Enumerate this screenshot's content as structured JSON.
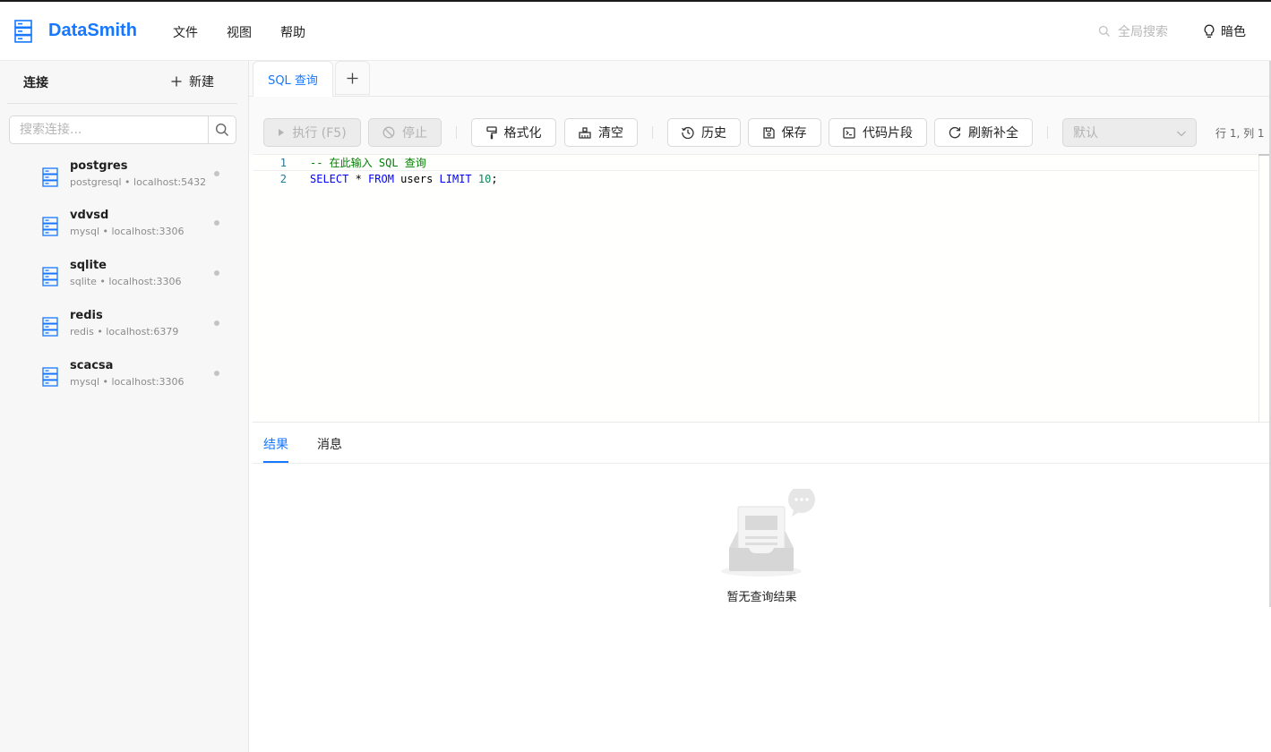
{
  "header": {
    "app_title": "DataSmith",
    "menu": [
      "文件",
      "视图",
      "帮助"
    ],
    "global_search_placeholder": "全局搜索",
    "theme_label": "暗色"
  },
  "sidebar": {
    "title": "连接",
    "new_label": "新建",
    "search_placeholder": "搜索连接...",
    "connections": [
      {
        "name": "postgres",
        "meta": "postgresql • localhost:5432"
      },
      {
        "name": "vdvsd",
        "meta": "mysql • localhost:3306"
      },
      {
        "name": "sqlite",
        "meta": "sqlite • localhost:3306"
      },
      {
        "name": "redis",
        "meta": "redis • localhost:6379"
      },
      {
        "name": "scacsa",
        "meta": "mysql • localhost:3306"
      }
    ]
  },
  "tabs": {
    "active_label": "SQL 查询",
    "add_label": "+"
  },
  "toolbar": {
    "run_label": "执行 (F5)",
    "stop_label": "停止",
    "format_label": "格式化",
    "clear_label": "清空",
    "history_label": "历史",
    "save_label": "保存",
    "snippets_label": "代码片段",
    "refresh_label": "刷新补全",
    "database_select": "默认",
    "cursor_position": "行 1, 列 1"
  },
  "editor": {
    "lines": [
      {
        "num": "1",
        "comment": "-- 在此输入 SQL 查询"
      },
      {
        "num": "2",
        "kw1": "SELECT",
        "star": " * ",
        "kw2": "FROM",
        "table": " users ",
        "kw3": "LIMIT",
        "num_val": " 10",
        "end": ";"
      }
    ]
  },
  "results": {
    "tabs": [
      "结果",
      "消息"
    ],
    "empty_text": "暂无查询结果"
  },
  "colors": {
    "accent": "#1677ff",
    "comment": "#008000",
    "keyword": "#0000ff"
  }
}
